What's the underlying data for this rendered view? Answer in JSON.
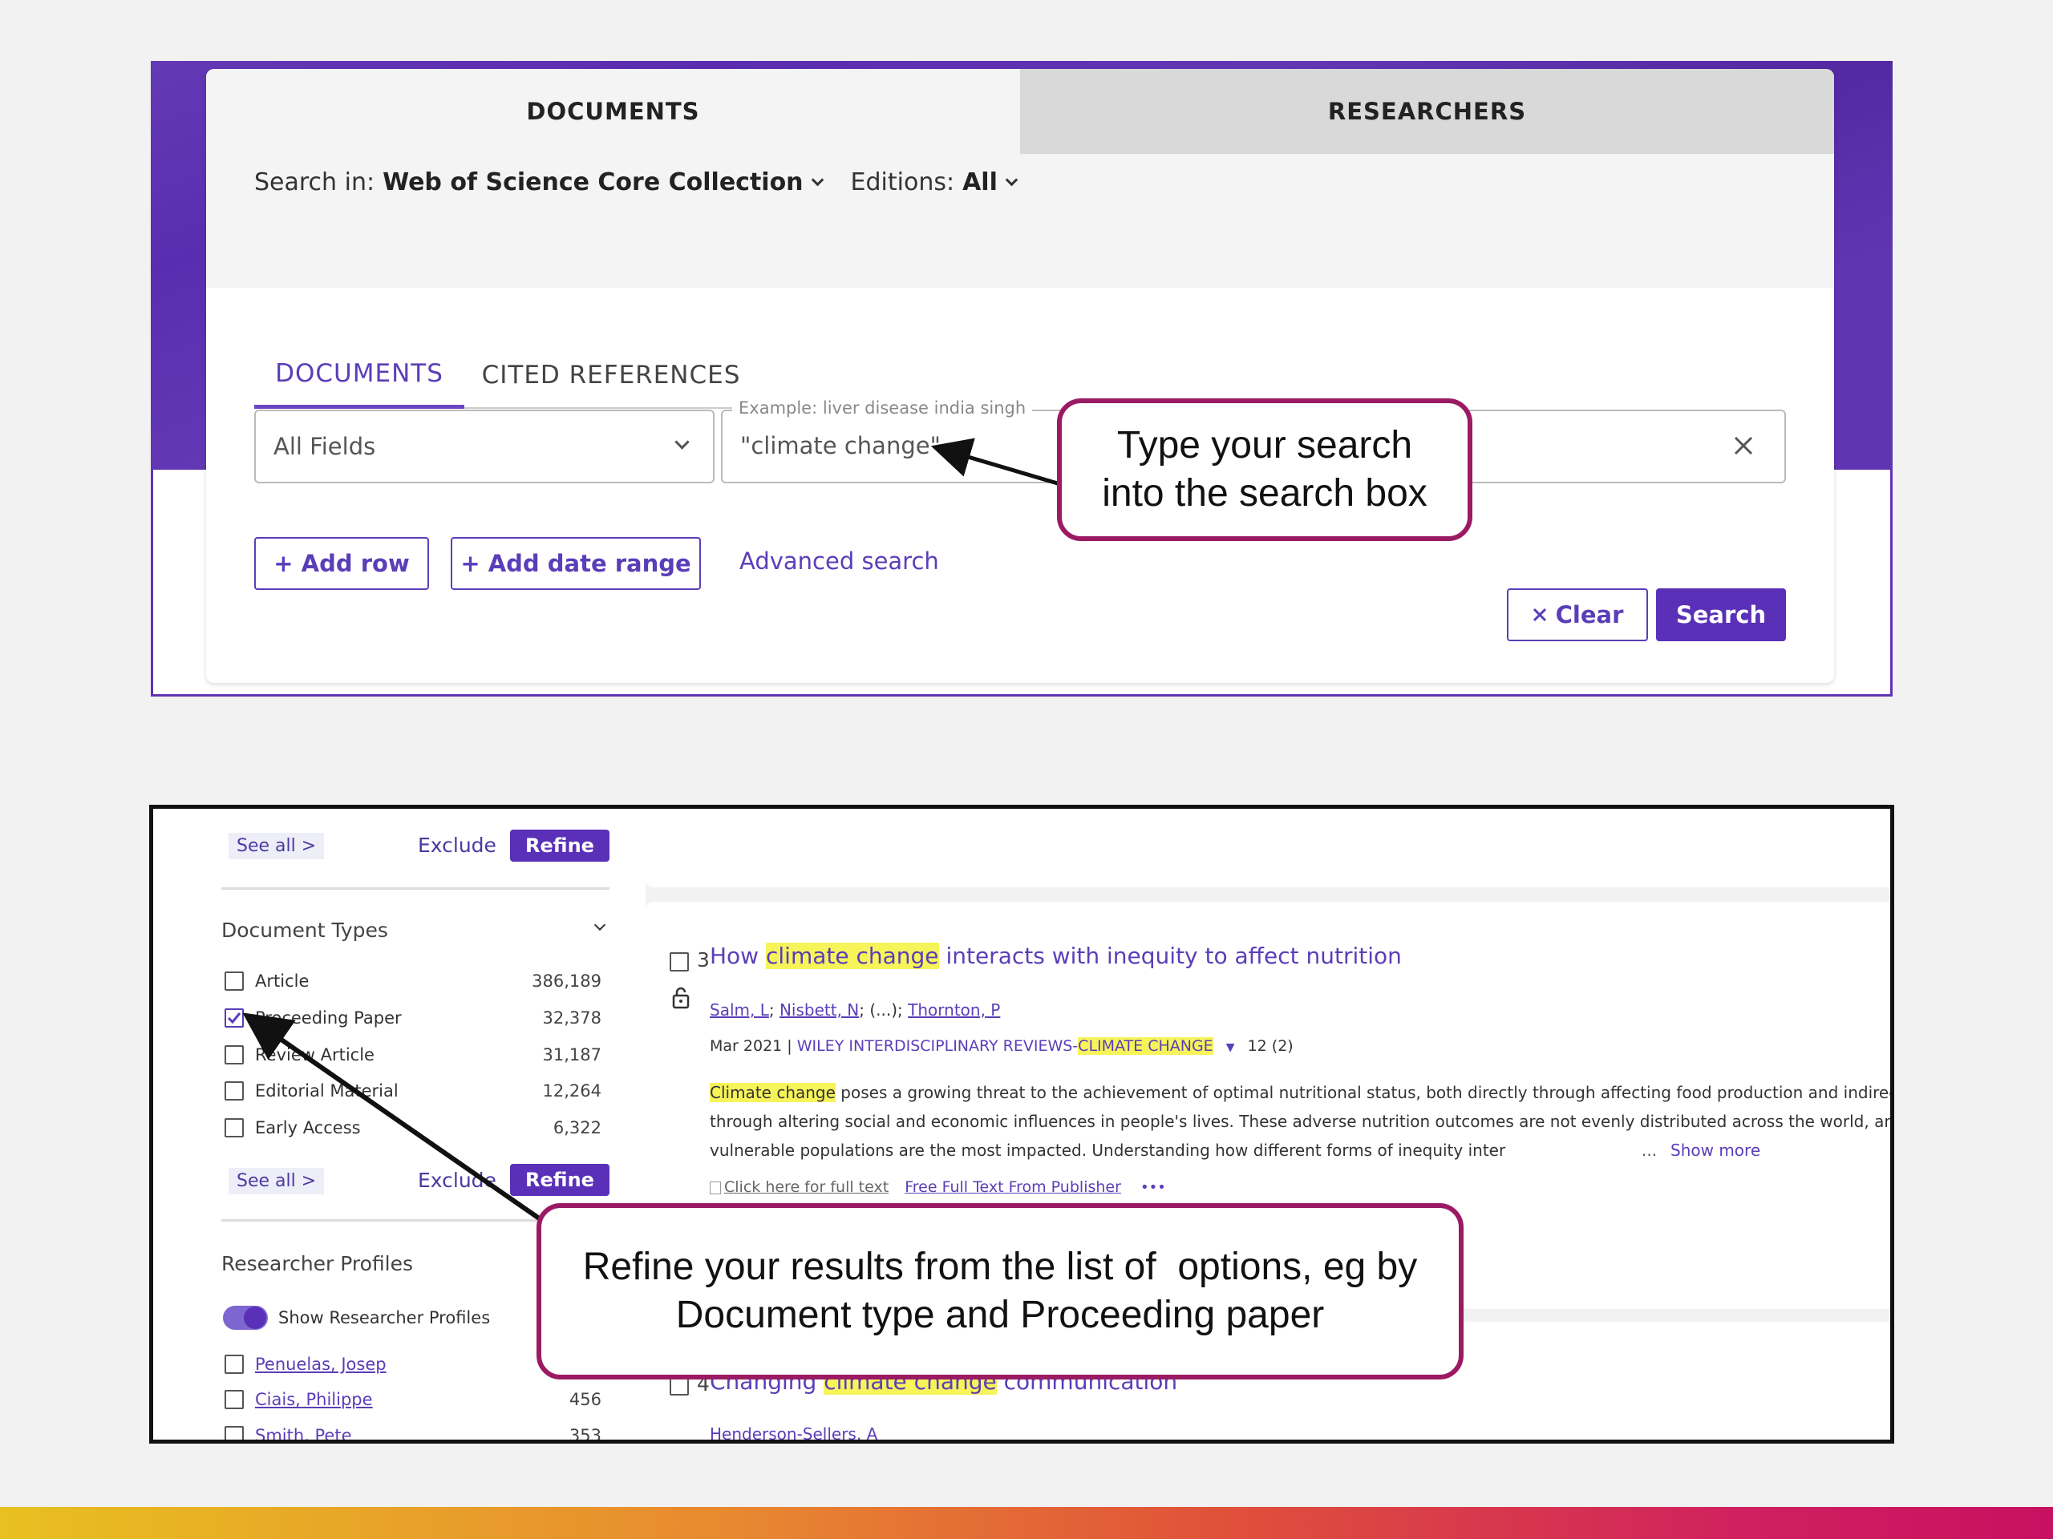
{
  "top": {
    "main_tabs": [
      "DOCUMENTS",
      "RESEARCHERS"
    ],
    "search_in_label": "Search in:",
    "search_in_value": "Web of Science Core Collection",
    "editions_label": "Editions:",
    "editions_value": "All",
    "sub_tabs": [
      "DOCUMENTS",
      "CITED REFERENCES"
    ],
    "field_select": "All Fields",
    "search_placeholder": "Example: liver disease india singh",
    "search_value": "\"climate change\"",
    "add_row": "+ Add row",
    "add_date_range": "+ Add date range",
    "advanced_search": "Advanced search",
    "clear": "Clear",
    "search": "Search"
  },
  "callouts": {
    "first_line1": "Type your search",
    "first_line2": "into the search box",
    "second_line1": "Refine your results from the list of  options, eg by",
    "second_line2": "Document type and Proceeding paper"
  },
  "bottom": {
    "see_all": "See all >",
    "exclude": "Exclude",
    "refine": "Refine",
    "document_types_title": "Document Types",
    "document_types": [
      {
        "label": "Article",
        "count": "386,189",
        "checked": false
      },
      {
        "label": "Proceeding Paper",
        "count": "32,378",
        "checked": true
      },
      {
        "label": "Review Article",
        "count": "31,187",
        "checked": false
      },
      {
        "label": "Editorial Material",
        "count": "12,264",
        "checked": false
      },
      {
        "label": "Early Access",
        "count": "6,322",
        "checked": false
      }
    ],
    "researcher_profiles_title": "Researcher Profiles",
    "show_researcher_profiles": "Show Researcher Profiles",
    "researchers": [
      {
        "label": "Penuelas, Josep",
        "count": ""
      },
      {
        "label": "Ciais, Philippe",
        "count": "456"
      },
      {
        "label": "Smith, Pete",
        "count": "353"
      }
    ],
    "result": {
      "number": "3",
      "title_pre": "How ",
      "title_hl": "climate change",
      "title_post": " interacts with inequity to affect nutrition",
      "author1": "Salm, L",
      "author2": "Nisbett, N",
      "author_gap": "; (...); ",
      "author3": "Thornton, P",
      "date": "Mar 2021 | ",
      "journal_pre": "WILEY INTERDISCIPLINARY REVIEWS-",
      "journal_hl": "CLIMATE CHANGE",
      "citations": "12 (2)",
      "abstract_hl": "Climate change",
      "abstract_line1": " poses a growing threat to the achievement of optimal nutritional status, both directly through affecting food production and indirectly",
      "abstract_line2": "through altering social and economic influences in people's lives. These adverse nutrition outcomes are not evenly distributed across the world, and",
      "abstract_line3": "vulnerable populations are the most impacted. Understanding how different forms of inequity inter",
      "ellipsis": "...",
      "show_more": "Show more",
      "fulltext_img_alt": "Click here for full text",
      "free_full_text": "Free Full Text From Publisher",
      "more": "•••"
    },
    "result2": {
      "number": "4",
      "title_pre": "Changing ",
      "title_hl": "climate change",
      "title_post": " communication",
      "author": "Henderson-Sellers, A"
    }
  },
  "colors": {
    "purple": "#5a30b8",
    "callout_border": "#9b1a64",
    "highlight": "#f7f45a"
  }
}
